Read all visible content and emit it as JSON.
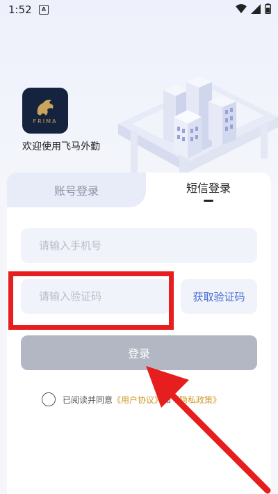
{
  "status": {
    "time": "1:52",
    "notif_icon": "A"
  },
  "app": {
    "logo_text": "FRIMA",
    "welcome": "欢迎使用飞马外勤"
  },
  "tabs": [
    {
      "label": "账号登录",
      "active": false
    },
    {
      "label": "短信登录",
      "active": true
    }
  ],
  "form": {
    "phone_placeholder": "请输入手机号",
    "code_placeholder": "请输入验证码",
    "get_code_label": "获取验证码",
    "login_label": "登录"
  },
  "agreement": {
    "prefix": "已阅读并同意",
    "user_agreement": "《用户协议》",
    "conj": "和",
    "privacy_policy": "《隐私政策》"
  },
  "colors": {
    "accent": "#4a6fd6",
    "link": "#d09a2c",
    "annotation_red": "#e61e1e",
    "button_disabled": "#b3b7c3"
  }
}
